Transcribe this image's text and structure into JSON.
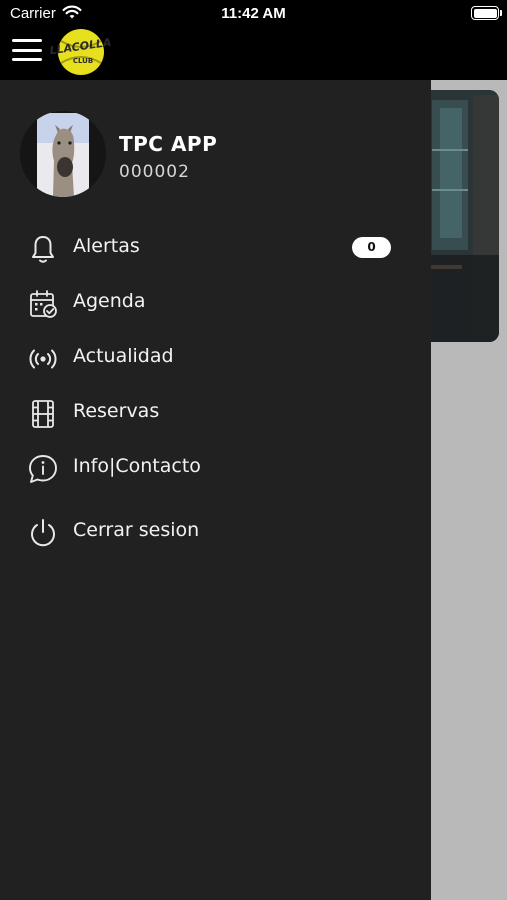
{
  "status_bar": {
    "carrier": "Carrier",
    "time": "11:42 AM",
    "wifi_icon": "wifi-icon",
    "battery_icon": "battery-icon"
  },
  "header": {
    "menu_icon": "hamburger-menu-icon",
    "logo_text": "LLACOLLA CLUB"
  },
  "profile": {
    "name": "TPC APP",
    "id": "000002"
  },
  "menu": {
    "items": [
      {
        "label": "Alertas",
        "icon": "bell-icon",
        "badge": "0"
      },
      {
        "label": "Agenda",
        "icon": "calendar-check-icon"
      },
      {
        "label": "Actualidad",
        "icon": "broadcast-icon"
      },
      {
        "label": "Reservas",
        "icon": "film-strip-icon"
      },
      {
        "label": "Info|Contacto",
        "icon": "info-chat-icon"
      },
      {
        "label": "Cerrar sesion",
        "icon": "power-icon"
      }
    ]
  },
  "colors": {
    "drawer_bg": "#212121",
    "header_bg": "#000000",
    "overlay_bg": "#b9b9b9",
    "text": "#ffffff",
    "logo_yellow": "#e6e01f"
  }
}
